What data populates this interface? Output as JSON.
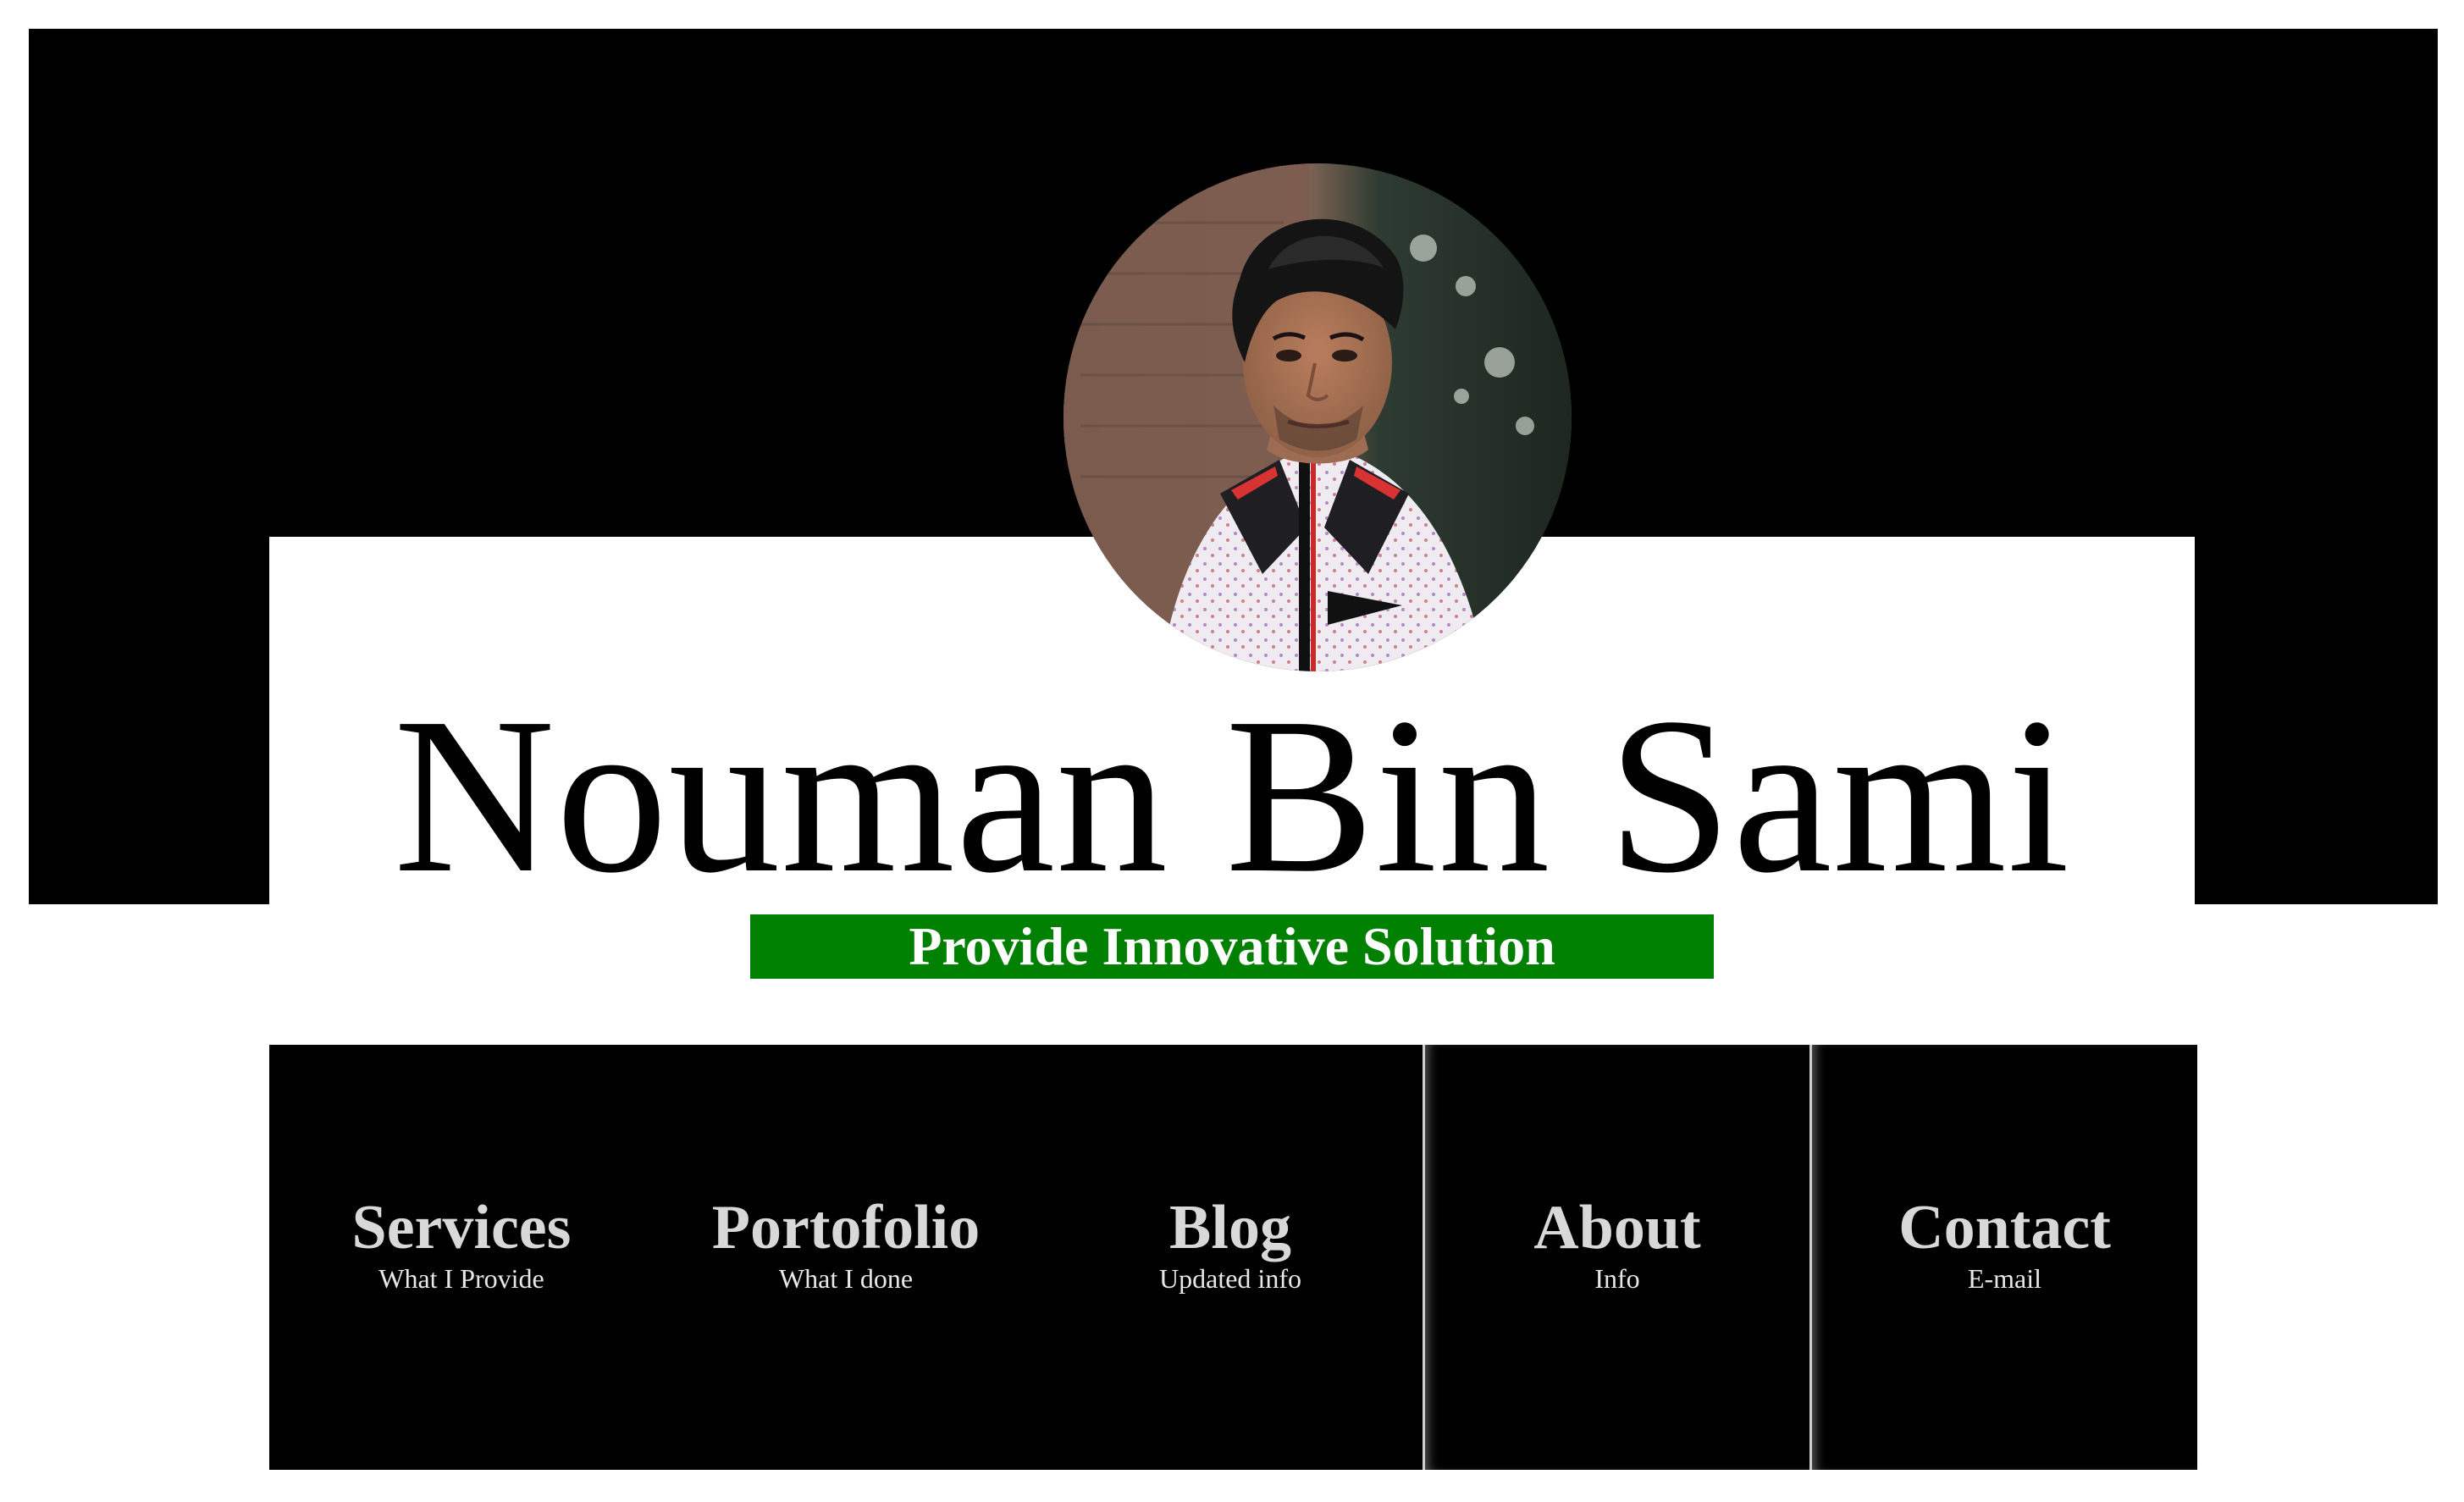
{
  "profile": {
    "name": "Nouman Bin Sami",
    "tagline": "Provide Innovative Solution",
    "avatar_alt": "profile-photo"
  },
  "colors": {
    "hero_background": "#000000",
    "card_background": "#ffffff",
    "tagline_background": "#008000",
    "tagline_text": "#ffffff",
    "nav_background": "#000000",
    "nav_title": "#d8d8d8",
    "nav_subtitle": "#e8e8e8"
  },
  "nav": {
    "items": [
      {
        "title": "Services",
        "subtitle": "What I Provide"
      },
      {
        "title": "Portofolio",
        "subtitle": "What I done"
      },
      {
        "title": "Blog",
        "subtitle": "Updated info"
      },
      {
        "title": "About",
        "subtitle": "Info"
      },
      {
        "title": "Contact",
        "subtitle": "E-mail"
      }
    ]
  }
}
